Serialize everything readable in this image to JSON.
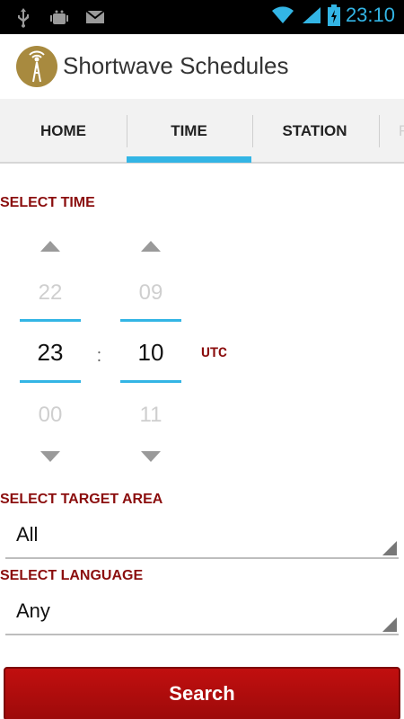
{
  "status_bar": {
    "time": "23:10",
    "icons": [
      "usb-icon",
      "android-debug-icon",
      "gmail-icon",
      "wifi-icon",
      "signal-icon",
      "battery-charging-icon"
    ]
  },
  "app": {
    "title": "Shortwave Schedules",
    "logo_icon": "radio-tower-icon"
  },
  "tabs": [
    {
      "label": "HOME",
      "active": false
    },
    {
      "label": "TIME",
      "active": true
    },
    {
      "label": "STATION",
      "active": false
    },
    {
      "label": "F",
      "active": false
    }
  ],
  "time_section": {
    "label": "SELECT TIME",
    "hour": {
      "prev": "22",
      "current": "23",
      "next": "00"
    },
    "minute": {
      "prev": "09",
      "current": "10",
      "next": "11"
    },
    "separator": ":",
    "timezone": "UTC"
  },
  "target_area": {
    "label": "SELECT TARGET AREA",
    "value": "All"
  },
  "language": {
    "label": "SELECT LANGUAGE",
    "value": "Any"
  },
  "search_button": {
    "label": "Search"
  },
  "colors": {
    "accent_blue": "#33b5e5",
    "label_red": "#8b0e0e",
    "button_red": "#b30d0d"
  }
}
